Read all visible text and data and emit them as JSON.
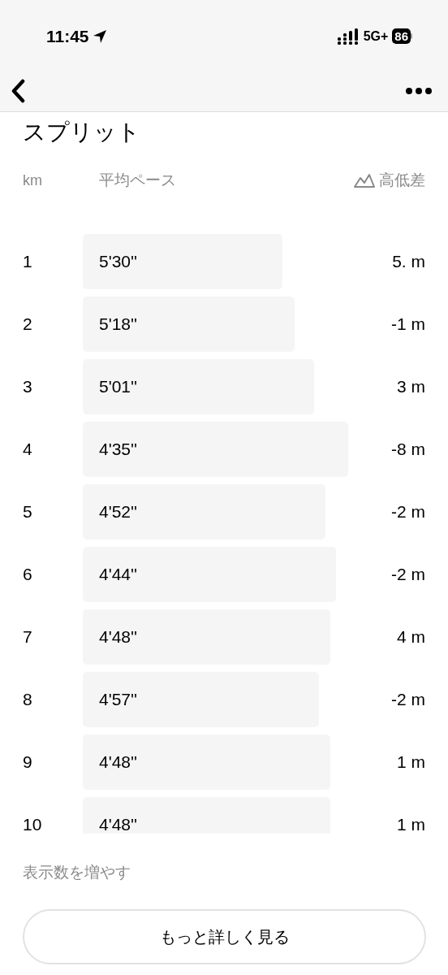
{
  "status_bar": {
    "time": "11:45",
    "network": "5G+",
    "battery": "86"
  },
  "title": "スプリット",
  "columns": {
    "km": "km",
    "pace": "平均ペース",
    "elevation": "高低差"
  },
  "splits": [
    {
      "km": "1",
      "pace": "5'30''",
      "elevation": "5. m"
    },
    {
      "km": "2",
      "pace": "5'18''",
      "elevation": "-1 m"
    },
    {
      "km": "3",
      "pace": "5'01''",
      "elevation": "3 m"
    },
    {
      "km": "4",
      "pace": "4'35''",
      "elevation": "-8 m"
    },
    {
      "km": "5",
      "pace": "4'52''",
      "elevation": "-2 m"
    },
    {
      "km": "6",
      "pace": "4'44''",
      "elevation": "-2 m"
    },
    {
      "km": "7",
      "pace": "4'48''",
      "elevation": "4 m"
    },
    {
      "km": "8",
      "pace": "4'57''",
      "elevation": "-2 m"
    },
    {
      "km": "9",
      "pace": "4'48''",
      "elevation": "1 m"
    },
    {
      "km": "10",
      "pace": "4'48''",
      "elevation": "1 m"
    }
  ],
  "show_more": "表示数を増やす",
  "details_button": "もっと詳しく見る"
}
